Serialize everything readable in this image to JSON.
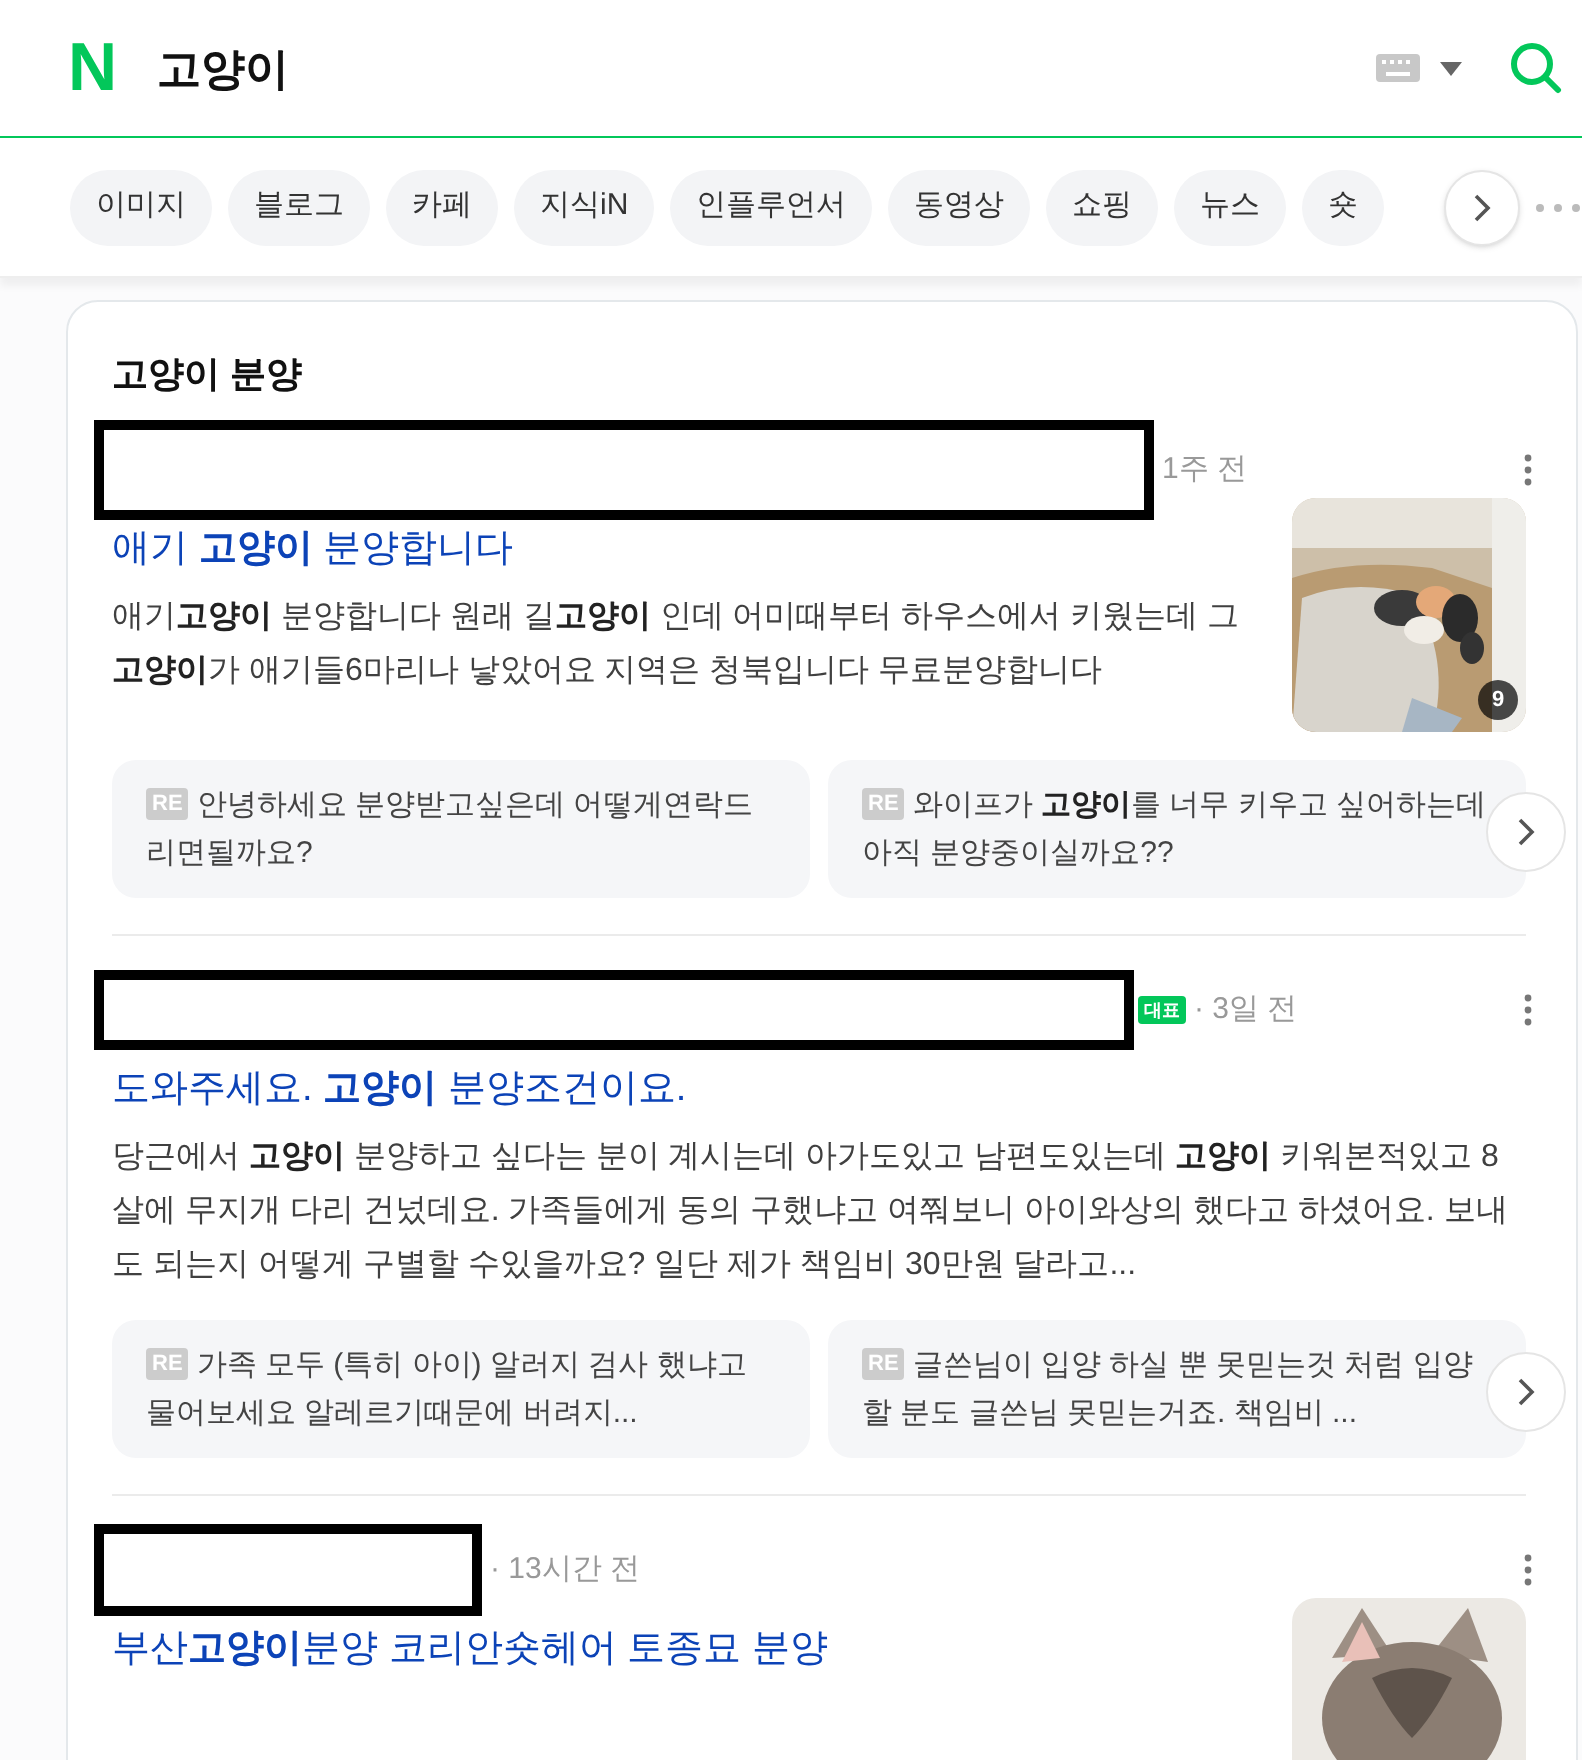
{
  "header": {
    "logo": "N",
    "query": "고양이"
  },
  "tabs": [
    {
      "label": "이미지"
    },
    {
      "label": "블로그"
    },
    {
      "label": "카페"
    },
    {
      "label": "지식iN"
    },
    {
      "label": "인플루언서"
    },
    {
      "label": "동영상"
    },
    {
      "label": "쇼핑"
    },
    {
      "label": "뉴스"
    },
    {
      "label": "숏"
    }
  ],
  "section": {
    "title": "고양이 분양",
    "posts": [
      {
        "time": "1주 전",
        "title": "애기 **고양이** 분양합니다",
        "snippet": "애기**고양이** 분양합니다 원래 길**고양이** 인데 어미때부터 하우스에서 키웠는데 그**고양이**가 애기들6마리나 낳았어요 지역은 청북입니다 무료분양합니다",
        "thumbnail": {
          "kind": "picture",
          "count": "9"
        },
        "replies": [
          {
            "tag": "RE",
            "text": "안녕하세요 분양받고싶은데 어떻게연락드리면될까요?"
          },
          {
            "tag": "RE",
            "text": "와이프가 **고양이**를 너무 키우고 싶어하는데 아직 분양중이실까요??"
          }
        ]
      },
      {
        "badge": "대표",
        "time": "· 3일 전",
        "title": "도와주세요. **고양이** 분양조건이요.",
        "snippet": "당근에서 **고양이** 분양하고 싶다는 분이 계시는데 아가도있고 남편도있는데 **고양이** 키워본적있고 8살에 무지개 다리 건넜데요. 가족들에게 동의 구했냐고 여쭤보니 아이와상의 했다고 하셨어요. 보내도 되는지 어떻게 구별할 수있을까요? 일단 제가 책임비 30만원 달라고...",
        "replies": [
          {
            "tag": "RE",
            "text": "가족 모두 (특히 아이) 알러지 검사 했냐고 물어보세요 알레르기때문에 버려지..."
          },
          {
            "tag": "RE",
            "text": "글쓴님이 입양 하실 뿐 못믿는것 처럼 입양할 분도 글쓴님 못믿는거죠. 책임비 ..."
          }
        ]
      },
      {
        "time": "· 13시간 전",
        "title": "부산**고양이**분양 코리안숏헤어 토종묘 분양"
      }
    ]
  }
}
